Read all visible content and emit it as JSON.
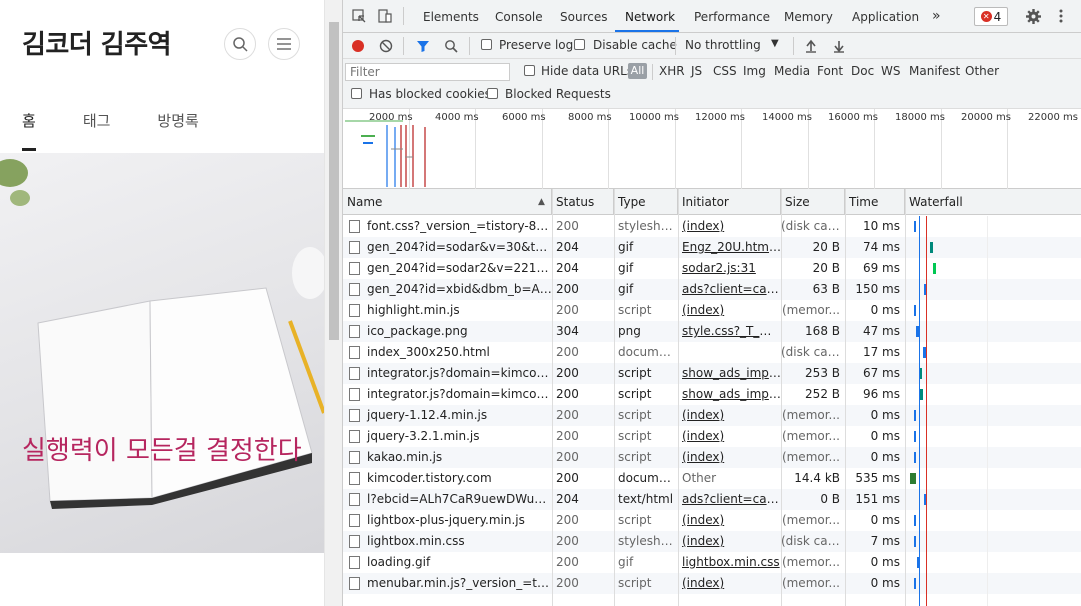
{
  "blog": {
    "title": "김코더 김주역",
    "nav": [
      "홈",
      "태그",
      "방명록"
    ],
    "hero_text": "실행력이 모든걸 결정한다"
  },
  "devtools": {
    "tabs": [
      "Elements",
      "Console",
      "Sources",
      "Network",
      "Performance",
      "Memory",
      "Application"
    ],
    "active_tab": "Network",
    "more_tabs": "»",
    "error_count": "4",
    "toolbar": {
      "preserve_log": "Preserve log",
      "disable_cache": "Disable cache",
      "throttling": "No throttling",
      "throttling_arrow": "▼"
    },
    "filter": {
      "placeholder": "Filter",
      "hide_data_urls": "Hide data URLs",
      "types": [
        "All",
        "XHR",
        "JS",
        "CSS",
        "Img",
        "Media",
        "Font",
        "Doc",
        "WS",
        "Manifest",
        "Other"
      ],
      "has_blocked_cookies": "Has blocked cookies",
      "blocked_requests": "Blocked Requests"
    },
    "overview_labels": [
      "2000 ms",
      "4000 ms",
      "6000 ms",
      "8000 ms",
      "10000 ms",
      "12000 ms",
      "14000 ms",
      "16000 ms",
      "18000 ms",
      "20000 ms",
      "22000 ms"
    ],
    "columns": [
      "Name",
      "Status",
      "Type",
      "Initiator",
      "Size",
      "Time",
      "Waterfall"
    ],
    "rows": [
      {
        "name": "font.css?_version_=tistory-8663c...",
        "status": "200",
        "type": "stylesheet",
        "initiator": "(index)",
        "size": "(disk cac...",
        "time": "10 ms"
      },
      {
        "name": "gen_204?id=sodar&v=30&t=2&...",
        "status": "204",
        "type": "gif",
        "initiator": "Engz_20U.html:35",
        "size": "20 B",
        "time": "74 ms"
      },
      {
        "name": "gen_204?id=sodar2&v=221&t=...",
        "status": "204",
        "type": "gif",
        "initiator": "sodar2.js:31",
        "size": "20 B",
        "time": "69 ms"
      },
      {
        "name": "gen_204?id=xbid&dbm_b=AKA...",
        "status": "200",
        "type": "gif",
        "initiator": "ads?client=ca-p...",
        "size": "63 B",
        "time": "150 ms"
      },
      {
        "name": "highlight.min.js",
        "status": "200",
        "type": "script",
        "initiator": "(index)",
        "size": "(memor...",
        "time": "0 ms"
      },
      {
        "name": "ico_package.png",
        "status": "304",
        "type": "png",
        "initiator": "style.css?_T_=1...",
        "size": "168 B",
        "time": "47 ms"
      },
      {
        "name": "index_300x250.html",
        "status": "200",
        "type": "document",
        "initiator": "",
        "size": "(disk cac...",
        "time": "17 ms"
      },
      {
        "name": "integrator.js?domain=kimcoder....",
        "status": "200",
        "type": "script",
        "initiator": "show_ads_impl_...",
        "size": "253 B",
        "time": "67 ms"
      },
      {
        "name": "integrator.js?domain=kimcoder....",
        "status": "200",
        "type": "script",
        "initiator": "show_ads_impl_...",
        "size": "252 B",
        "time": "96 ms"
      },
      {
        "name": "jquery-1.12.4.min.js",
        "status": "200",
        "type": "script",
        "initiator": "(index)",
        "size": "(memor...",
        "time": "0 ms"
      },
      {
        "name": "jquery-3.2.1.min.js",
        "status": "200",
        "type": "script",
        "initiator": "(index)",
        "size": "(memor...",
        "time": "0 ms"
      },
      {
        "name": "kakao.min.js",
        "status": "200",
        "type": "script",
        "initiator": "(index)",
        "size": "(memor...",
        "time": "0 ms"
      },
      {
        "name": "kimcoder.tistory.com",
        "status": "200",
        "type": "document",
        "initiator": "Other",
        "size": "14.4 kB",
        "time": "535 ms"
      },
      {
        "name": "l?ebcid=ALh7CaR9uewDWuLNA...",
        "status": "204",
        "type": "text/html",
        "initiator": "ads?client=ca-p...",
        "size": "0 B",
        "time": "151 ms"
      },
      {
        "name": "lightbox-plus-jquery.min.js",
        "status": "200",
        "type": "script",
        "initiator": "(index)",
        "size": "(memor...",
        "time": "0 ms"
      },
      {
        "name": "lightbox.min.css",
        "status": "200",
        "type": "stylesheet",
        "initiator": "(index)",
        "size": "(disk cac...",
        "time": "7 ms"
      },
      {
        "name": "loading.gif",
        "status": "200",
        "type": "gif",
        "initiator": "lightbox.min.css",
        "size": "(memor...",
        "time": "0 ms"
      },
      {
        "name": "menubar.min.js?_version_=tistor...",
        "status": "200",
        "type": "script",
        "initiator": "(index)",
        "size": "(memor...",
        "time": "0 ms"
      }
    ],
    "colors": {
      "accent": "#1a73e8",
      "record": "#d93025",
      "hero_text": "#b6265f"
    }
  }
}
